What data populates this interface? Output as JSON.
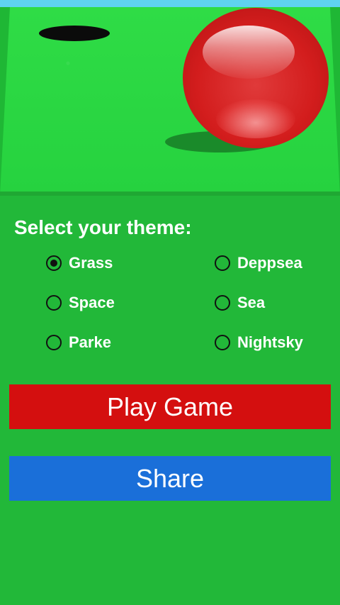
{
  "theme_prompt": "Select your theme:",
  "themes": [
    {
      "label": "Grass",
      "selected": true
    },
    {
      "label": "Deppsea",
      "selected": false
    },
    {
      "label": "Space",
      "selected": false
    },
    {
      "label": "Sea",
      "selected": false
    },
    {
      "label": "Parke",
      "selected": false
    },
    {
      "label": "Nightsky",
      "selected": false
    }
  ],
  "buttons": {
    "play": "Play Game",
    "share": "Share"
  },
  "colors": {
    "grass": "#22b839",
    "ball": "#d31d1d",
    "play_button": "#d40f0f",
    "share_button": "#1a6fd9"
  }
}
